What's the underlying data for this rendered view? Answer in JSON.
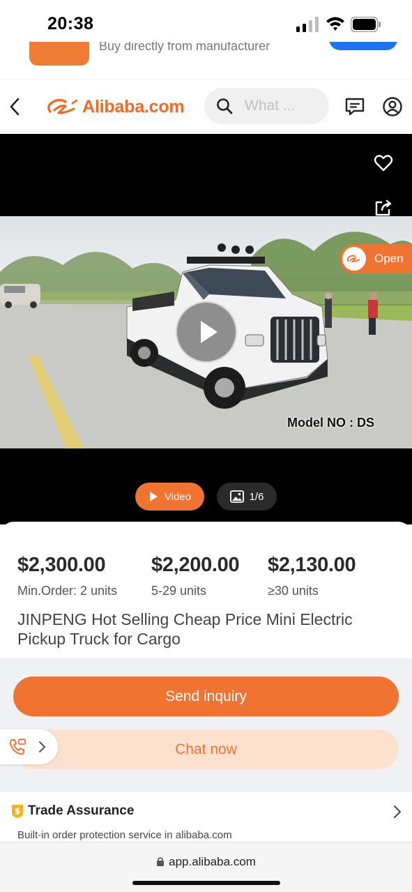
{
  "status_bar": {
    "time": "20:38"
  },
  "banner": {
    "text": "Buy directly from manufacturer"
  },
  "header": {
    "logo_text": "Alibaba.com",
    "search_placeholder": "What ...",
    "search_value": ""
  },
  "media": {
    "open_label": "Open",
    "model_text": "Model NO : DS",
    "video_label": "Video",
    "image_counter": "1/6"
  },
  "pricing": [
    {
      "price": "$2,300.00",
      "tier": "Min.Order: 2 units"
    },
    {
      "price": "$2,200.00",
      "tier": "5-29 units"
    },
    {
      "price": "$2,130.00",
      "tier": "≥30 units"
    }
  ],
  "product": {
    "title": "JINPENG Hot Selling Cheap Price Mini Electric Pickup Truck for Cargo"
  },
  "actions": {
    "inquiry_label": "Send inquiry",
    "chat_label": "Chat now"
  },
  "trade_assurance": {
    "title": "Trade Assurance",
    "subtitle": "Built-in order protection service in alibaba.com"
  },
  "browser": {
    "url": "app.alibaba.com"
  },
  "colors": {
    "accent": "#f07332",
    "brand": "#f06a28",
    "chat_bg": "#fde1cf",
    "section_bg": "#f0f1f5"
  },
  "icons": [
    "back-icon",
    "alibaba-logo-icon",
    "search-icon",
    "message-icon",
    "user-icon",
    "heart-icon",
    "share-icon",
    "play-icon",
    "video-icon",
    "image-icon",
    "phone-icon",
    "chevron-right-icon",
    "trade-assurance-icon",
    "lock-icon"
  ]
}
